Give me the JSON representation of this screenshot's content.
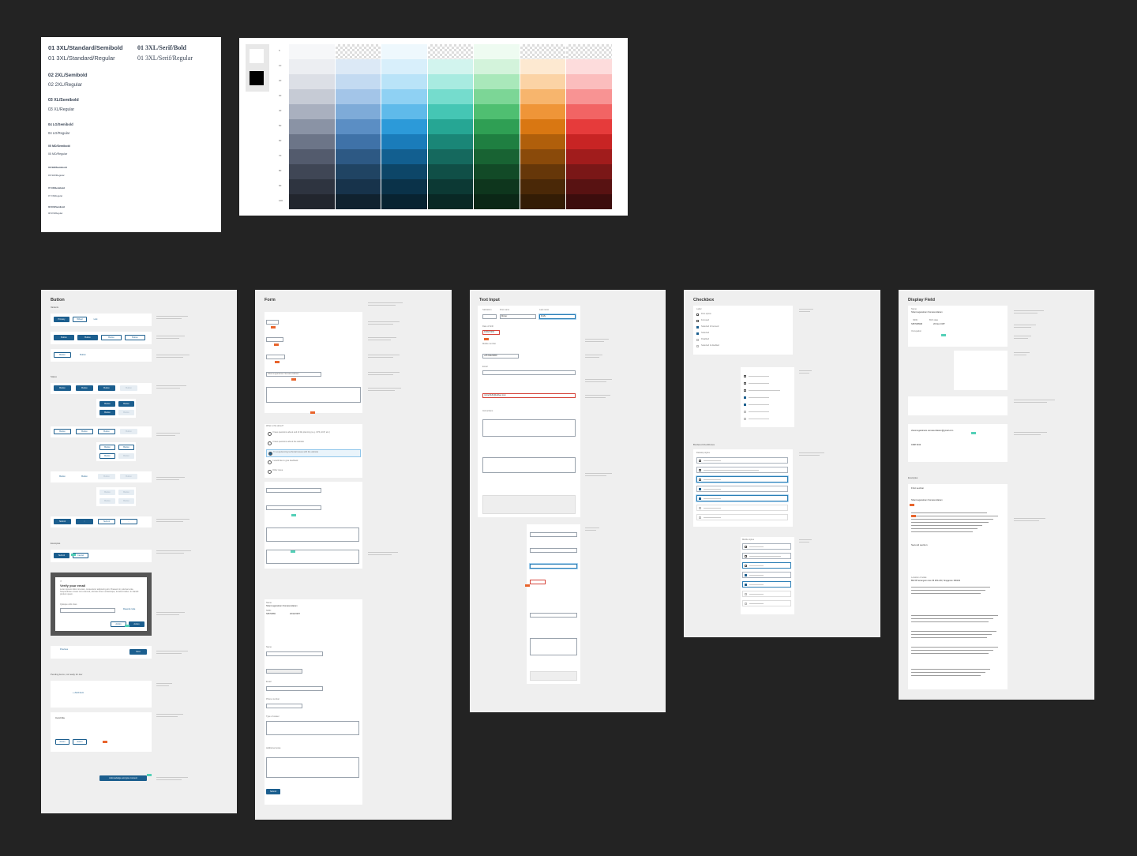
{
  "typography": {
    "col1": [
      "01 3XL/Standard/Semibold",
      "01 3XL/Standard/Regular",
      "02 2XL/Semibold",
      "02 2XL/Regular",
      "03 XL/Semibold",
      "03 XL/Regular",
      "04 LG/Semibold",
      "04 LG/Regular",
      "05 MD/Semibold",
      "05 MD/Regular",
      "06 SM/Semibold",
      "06 SM/Regular",
      "07 XS/Semibold",
      "07 XS/Regular",
      "08 2XS/Semibold",
      "08 2XS/Regular"
    ],
    "col2": [
      "01 3XL/Serif/Bold",
      "01 3XL/Serif/Regular"
    ]
  },
  "palette": {
    "steps": [
      "5",
      "10",
      "20",
      "30",
      "40",
      "50",
      "60",
      "70",
      "80",
      "90",
      "100"
    ],
    "colors": {
      "neutral": [
        "#f6f7f9",
        "#eceef2",
        "#dcdfe6",
        "#c6cbd5",
        "#a9b0bf",
        "#8a93a5",
        "#6c7588",
        "#535b6d",
        "#3f4655",
        "#2e3440",
        "#22262e"
      ],
      "blue": [
        "#f0f5fb",
        "#dce9f6",
        "#c3daf1",
        "#a3c5e8",
        "#7eabd8",
        "#5b8ec4",
        "#3f72a8",
        "#2d5984",
        "#204463",
        "#17334b",
        "#10222f"
      ],
      "cyan": [
        "#eef8fd",
        "#d8effb",
        "#b9e3f8",
        "#8fd1f3",
        "#5fbaea",
        "#2c9ad9",
        "#1a7cba",
        "#125f90",
        "#0d4668",
        "#0a3249",
        "#082331"
      ],
      "teal": [
        "#edfbf8",
        "#d2f4ee",
        "#a8ebe0",
        "#75dccd",
        "#45c6b4",
        "#26a694",
        "#1a8677",
        "#15695e",
        "#104f47",
        "#0c3934",
        "#092825"
      ],
      "green": [
        "#eefbf1",
        "#d3f3db",
        "#a9e8ba",
        "#7cd696",
        "#4fbf71",
        "#2f9f54",
        "#1f7f41",
        "#186333",
        "#124a27",
        "#0e361d",
        "#0b2716"
      ],
      "orange": [
        "#fef7ee",
        "#fde9d1",
        "#fbd3a5",
        "#f7b56d",
        "#ef9538",
        "#d97712",
        "#b05f0b",
        "#8a4a0a",
        "#663709",
        "#4a2807",
        "#331c05"
      ],
      "red": [
        "#fef1f1",
        "#fddcdc",
        "#fbbdbd",
        "#f89393",
        "#f26464",
        "#e63b3b",
        "#c82424",
        "#a11c1c",
        "#7a1717",
        "#581212",
        "#3c0d0d"
      ]
    },
    "black": "#000000",
    "white": "#ffffff"
  },
  "frames": {
    "button": {
      "title": "Button",
      "variants": "Variants",
      "states": "States",
      "examples": "Examples",
      "pending": "Pending items, not ready for dev",
      "primary": "Primary",
      "wheel": "Wheel",
      "link": "Link",
      "btn": "Button",
      "submit": "Submit",
      "cancel": "Cancel",
      "verify_title": "Verify your email",
      "verify_body": "Lorem ipsum dolor sit amet, consectetur adipiscing elit. Praesent in pulvinar ante. Suspendisse ornare nisi euismod, ultricies lorem scelerisque, tincidunt tellus. In blandit pretium quam.",
      "quisque": "Quisque odio risus",
      "resend": "Resend code",
      "action": "Action",
      "previous": "Previous",
      "next": "Next",
      "add_item": "+ Add item",
      "card_title": "Card title",
      "acknowledge": "Acknowledge and give consent"
    },
    "form": {
      "title": "Form",
      "name_value": "Shanmugaratnam Somasundaram",
      "fields": [
        "Name",
        "NRIC",
        "Email",
        "Phone number",
        "Type of career",
        "Additional notes"
      ],
      "radio_q": "What is this about?",
      "radios": [
        "I have questions about end of life planning (e.g. CPF, ACP, etc.)",
        "I have questions about the website",
        "I'm experiencing technical issues with the website",
        "I would like to give feedback",
        "Other issue"
      ],
      "nric_value": "S6574869",
      "dob_value": "20/12/1957",
      "submit": "Submit"
    },
    "text_input": {
      "title": "Text Input",
      "salutation": "Salutation",
      "first_name": "First name",
      "last_name": "Last name",
      "first_value": "Minter",
      "last_value": "Fluffy",
      "dob": "Date of birth",
      "dob_value": "19/02/1994",
      "mobile": "Mobile number",
      "mobile_value": "+65 91122000",
      "email": "Email",
      "email_value": "minterfluffy@abbey.com",
      "instructions": "Instructions"
    },
    "checkbox": {
      "title": "Checkbox",
      "label": "Label",
      "options": [
        "First option",
        "Focused",
        "Selected & focused",
        "Selected",
        "Disabled",
        "Selected & disabled"
      ],
      "bordered": "Bordered checkboxes",
      "desktop": "Desktop styles",
      "mobile": "Mobile styles",
      "unselected": "Unselected",
      "overflow": "Option with overflowing text Lorem ipsum dolor sit amet, consectetur adipiscing elit"
    },
    "display": {
      "title": "Display Field",
      "name_label": "Name",
      "name_value": "Shanmugaratnam Somasundaram",
      "nric_label": "NRIC",
      "nric_value": "S6574869M",
      "birth_label": "Birth date",
      "birth_value": "20 Dec 1957",
      "occupation": "Occupation",
      "examples": "Examples",
      "first_section": "First section",
      "second_section": "Second section",
      "email_value": "shanmugaratnam.somasundaram@gmail.com",
      "mobile_value": "9188 3344",
      "address": "Location of wake",
      "address_value": "Blk 66 Serangoon Ave 66 #03-233, Singapore 180194"
    }
  }
}
